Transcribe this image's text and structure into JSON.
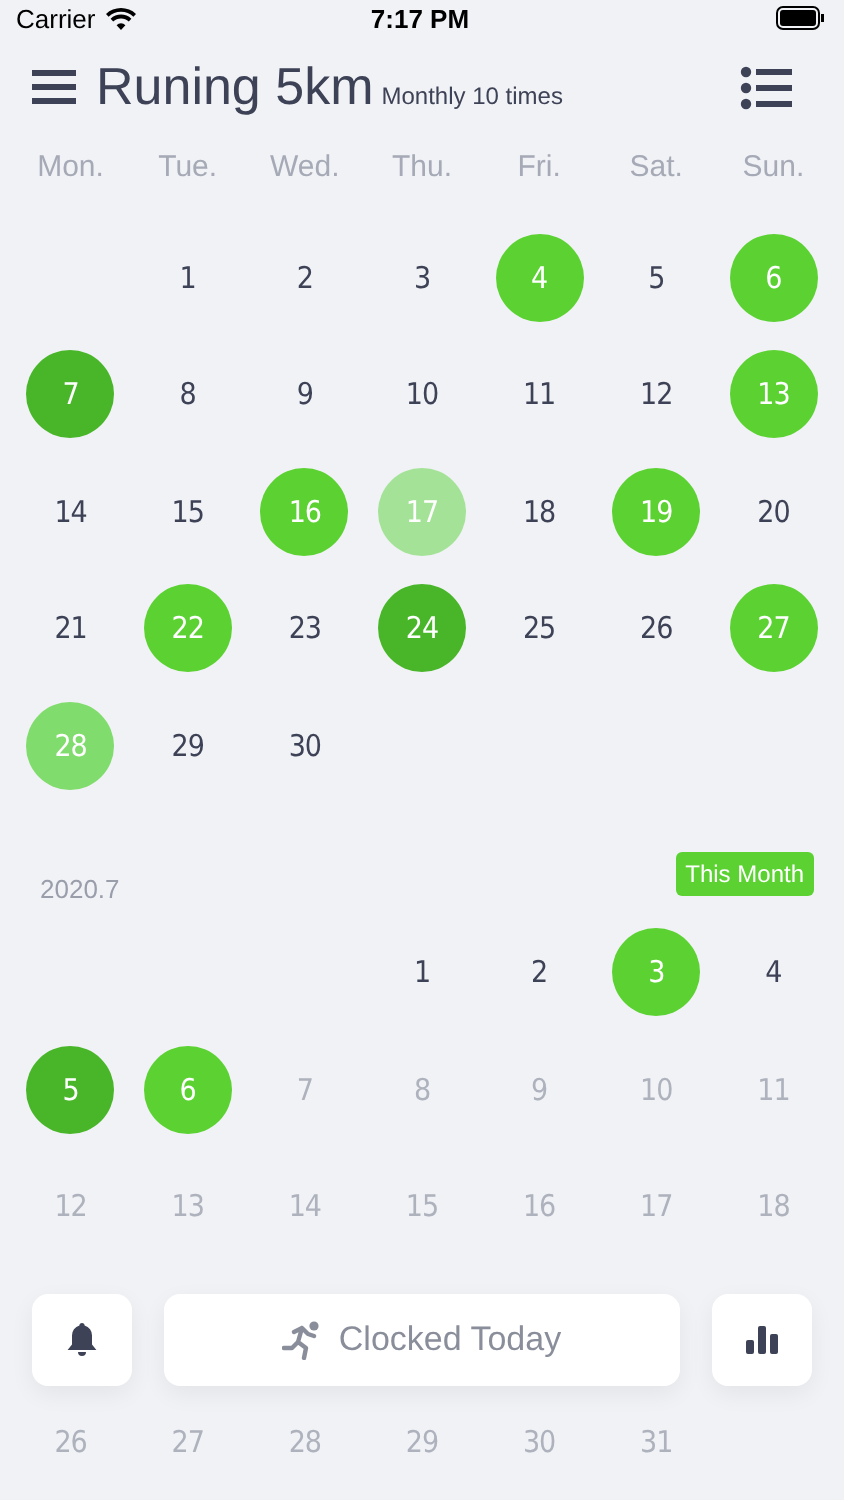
{
  "status_bar": {
    "carrier": "Carrier",
    "time": "7:17 PM"
  },
  "header": {
    "title": "Runing 5km",
    "subtitle": "Monthly 10 times"
  },
  "weekdays": [
    "Mon.",
    "Tue.",
    "Wed.",
    "Thu.",
    "Fri.",
    "Sat.",
    "Sun."
  ],
  "june": {
    "weeks": [
      {
        "days": [
          {
            "day": "1",
            "disabled": false
          },
          {
            "day": "2",
            "disabled": false
          },
          {
            "day": "3",
            "disabled": false
          },
          {
            "day": "4",
            "disabled": false,
            "color": "#5bd232"
          },
          {
            "day": "5",
            "disabled": false
          },
          {
            "day": "6",
            "disabled": false,
            "color": "#5bd232"
          }
        ]
      },
      {
        "days": [
          {
            "day": "7",
            "disabled": false,
            "color": "#49b62a"
          },
          {
            "day": "8",
            "disabled": false
          },
          {
            "day": "9",
            "disabled": false
          },
          {
            "day": "10",
            "disabled": false
          },
          {
            "day": "11",
            "disabled": false
          },
          {
            "day": "12",
            "disabled": false
          },
          {
            "day": "13",
            "disabled": false,
            "color": "#5bd232"
          }
        ]
      },
      {
        "days": [
          {
            "day": "14",
            "disabled": false
          },
          {
            "day": "15",
            "disabled": false
          },
          {
            "day": "16",
            "disabled": false,
            "color": "#5bd232"
          },
          {
            "day": "17",
            "disabled": false,
            "color": "#a4e397"
          },
          {
            "day": "18",
            "disabled": false
          },
          {
            "day": "19",
            "disabled": false,
            "color": "#5bd232"
          },
          {
            "day": "20",
            "disabled": false
          }
        ]
      },
      {
        "days": [
          {
            "day": "21",
            "disabled": false
          },
          {
            "day": "22",
            "disabled": false,
            "color": "#5bd232"
          },
          {
            "day": "23",
            "disabled": false
          },
          {
            "day": "24",
            "disabled": false,
            "color": "#49b62a"
          },
          {
            "day": "25",
            "disabled": false
          },
          {
            "day": "26",
            "disabled": false
          },
          {
            "day": "27",
            "disabled": false,
            "color": "#5bd232"
          }
        ]
      },
      {
        "days": [
          {
            "day": "28",
            "disabled": false,
            "color": "#80dc6c"
          },
          {
            "day": "29",
            "disabled": false
          },
          {
            "day": "30",
            "disabled": false
          }
        ]
      }
    ]
  },
  "july": {
    "label": "2020.7",
    "badge": "This Month",
    "weeks": [
      {
        "days": [
          {
            "day": "1",
            "disabled": false
          },
          {
            "day": "2",
            "disabled": false
          },
          {
            "day": "3",
            "disabled": false,
            "color": "#5bd232"
          },
          {
            "day": "4",
            "disabled": false
          }
        ]
      },
      {
        "days": [
          {
            "day": "5",
            "disabled": false,
            "color": "#49b62a"
          },
          {
            "day": "6",
            "disabled": false,
            "color": "#5bd232"
          },
          {
            "day": "7",
            "disabled": true
          },
          {
            "day": "8",
            "disabled": true
          },
          {
            "day": "9",
            "disabled": true
          },
          {
            "day": "10",
            "disabled": true
          },
          {
            "day": "11",
            "disabled": true
          }
        ]
      },
      {
        "days": [
          {
            "day": "12",
            "disabled": true
          },
          {
            "day": "13",
            "disabled": true
          },
          {
            "day": "14",
            "disabled": true
          },
          {
            "day": "15",
            "disabled": true
          },
          {
            "day": "16",
            "disabled": true
          },
          {
            "day": "17",
            "disabled": true
          },
          {
            "day": "18",
            "disabled": true
          }
        ]
      }
    ],
    "weeks_after_bar": [
      {
        "days": [
          {
            "day": "26",
            "disabled": true
          },
          {
            "day": "27",
            "disabled": true
          },
          {
            "day": "28",
            "disabled": true
          },
          {
            "day": "29",
            "disabled": true
          },
          {
            "day": "30",
            "disabled": true
          },
          {
            "day": "31",
            "disabled": true
          }
        ]
      }
    ]
  },
  "toolbar": {
    "clock_label": "Clocked Today"
  }
}
